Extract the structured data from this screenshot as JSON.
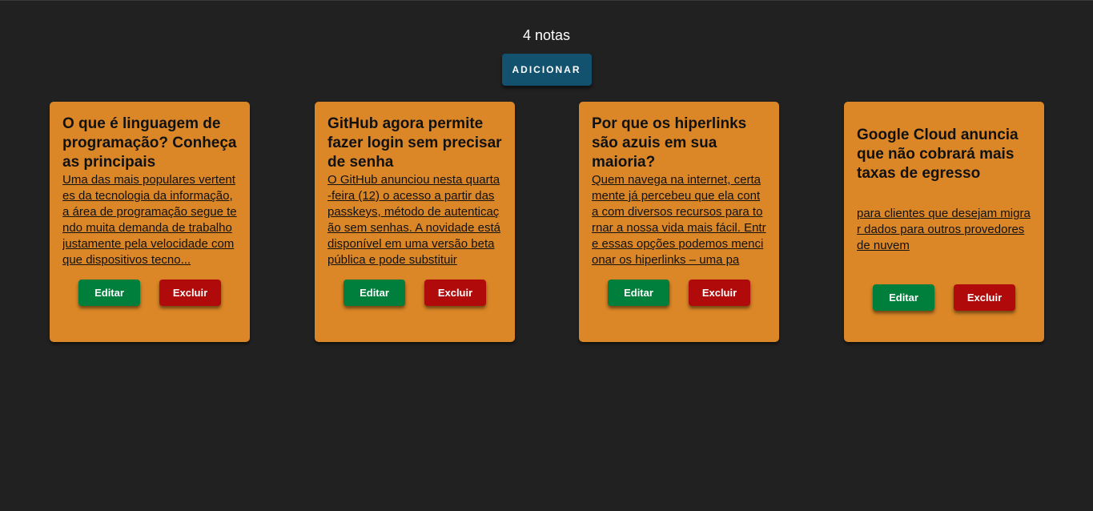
{
  "header": {
    "count_label": "4 notas",
    "add_label": "ADICIONAR"
  },
  "notes": [
    {
      "title": "O que é linguagem de programação? Conheça as principais",
      "text": "Uma das mais populares vertentes da tecnologia da informação, a área de programação segue tendo muita demanda de trabalho justamente pela velocidade com que dispositivos tecno...",
      "edit_label": "Editar",
      "delete_label": "Excluir"
    },
    {
      "title": "GitHub agora permite fazer login sem precisar de senha",
      "text": "O GitHub anunciou nesta quarta-feira (12) o acesso a partir das passkeys, método de autenticação sem senhas. A novidade está disponível em uma versão beta pública e pode substituir",
      "edit_label": "Editar",
      "delete_label": "Excluir"
    },
    {
      "title": "Por que os hiperlinks são azuis em sua maioria?",
      "text": "Quem navega na internet, certamente já percebeu que ela conta com diversos recursos para tornar a nossa vida mais fácil. Entre essas opções podemos mencionar os hiperlinks – uma pa",
      "edit_label": "Editar",
      "delete_label": "Excluir"
    },
    {
      "title": "Google Cloud anuncia que não cobrará mais taxas de egresso",
      "text": "para clientes que desejam migrar dados para outros provedores de nuvem",
      "edit_label": "Editar",
      "delete_label": "Excluir"
    }
  ],
  "colors": {
    "background": "#212121",
    "card": "#dc8727",
    "add_button": "#12526e",
    "edit_button": "#007f3c",
    "delete_button": "#b10a0a"
  }
}
